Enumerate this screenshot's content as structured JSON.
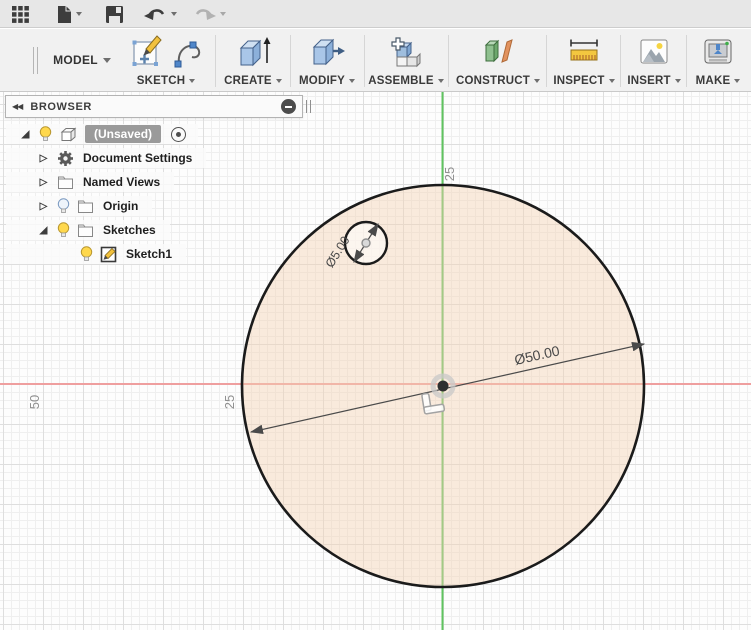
{
  "topbar": {
    "icons": [
      "app-grid",
      "file-new",
      "save",
      "undo",
      "redo"
    ]
  },
  "ribbon": {
    "workspace_label": "MODEL",
    "groups": [
      {
        "label": "SKETCH",
        "icons": [
          "create-sketch",
          "spline"
        ]
      },
      {
        "label": "CREATE",
        "icons": [
          "extrude"
        ]
      },
      {
        "label": "MODIFY",
        "icons": [
          "press-pull"
        ]
      },
      {
        "label": "ASSEMBLE",
        "icons": [
          "new-component"
        ]
      },
      {
        "label": "CONSTRUCT",
        "icons": [
          "construction-plane"
        ]
      },
      {
        "label": "INSPECT",
        "icons": [
          "measure"
        ]
      },
      {
        "label": "INSERT",
        "icons": [
          "insert-image"
        ]
      },
      {
        "label": "MAKE",
        "icons": [
          "3d-print"
        ]
      }
    ]
  },
  "browser": {
    "title": "BROWSER",
    "root": {
      "label": "(Unsaved)"
    },
    "items": [
      {
        "label": "Document Settings",
        "icon": "gear-icon",
        "state": "collapsed"
      },
      {
        "label": "Named Views",
        "icon": "folder-icon",
        "state": "collapsed"
      },
      {
        "label": "Origin",
        "icon": "folder-icon",
        "state": "collapsed",
        "visibility": "off"
      },
      {
        "label": "Sketches",
        "icon": "folder-icon",
        "state": "expanded",
        "visibility": "on"
      },
      {
        "label": "Sketch1",
        "icon": "sketch-icon",
        "visibility": "on"
      }
    ]
  },
  "canvas": {
    "dimension_large": "Ø50.00",
    "dimension_small": "Ø5.00",
    "grid_label_top": "25",
    "grid_label_mid": "25",
    "grid_label_far": "50",
    "colors": {
      "axis_x": "#ef9f9f",
      "axis_y": "#5fc45f",
      "profile_fill": "rgba(245,211,180,0.45)",
      "hole_fill": "rgba(255,255,255,0.55)",
      "sketch_stroke": "#1b1b1b",
      "dimension": "#4a4a4a"
    }
  }
}
